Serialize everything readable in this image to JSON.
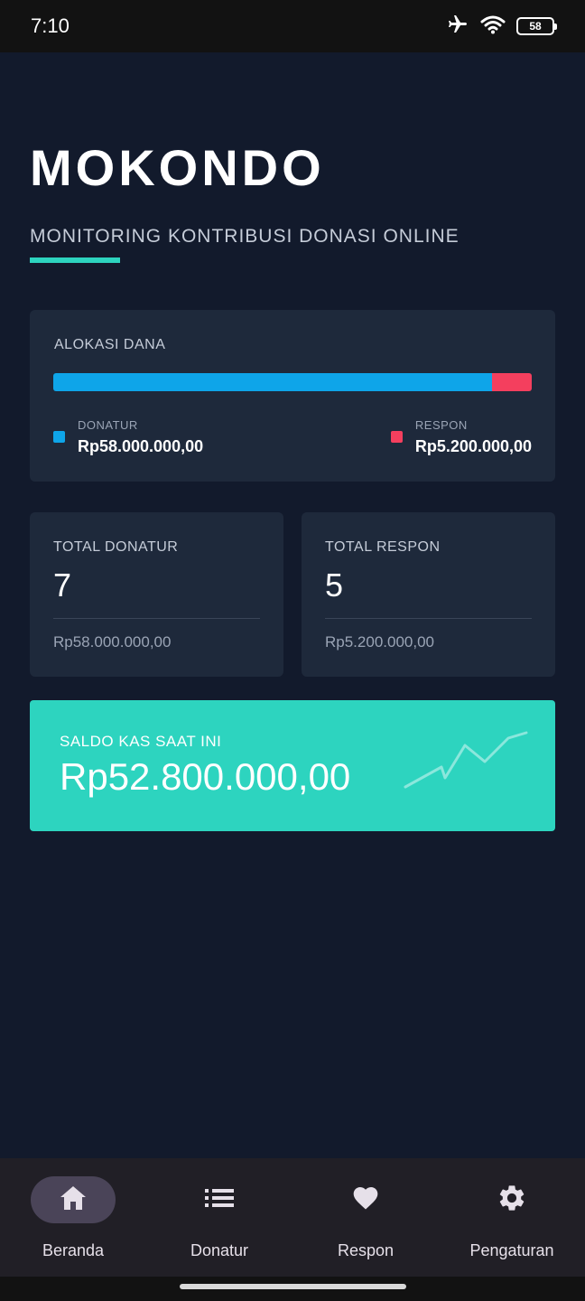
{
  "status_bar": {
    "time": "7:10",
    "battery": "58",
    "icons": [
      "airplane-icon",
      "wifi-icon",
      "battery-icon"
    ]
  },
  "header": {
    "title": "MOKONDO",
    "subtitle": "MONITORING KONTRIBUSI DONASI ONLINE"
  },
  "allocation": {
    "title": "ALOKASI DANA",
    "donatur_fraction": 0.9177,
    "donatur": {
      "label": "DONATUR",
      "value": "Rp58.000.000,00",
      "color": "#0ea5e9"
    },
    "respon": {
      "label": "RESPON",
      "value": "Rp5.200.000,00",
      "color": "#f43f5e"
    }
  },
  "stats": {
    "donatur": {
      "label": "TOTAL DONATUR",
      "count": "7",
      "amount": "Rp58.000.000,00"
    },
    "respon": {
      "label": "TOTAL RESPON",
      "count": "5",
      "amount": "Rp5.200.000,00"
    }
  },
  "balance": {
    "label": "SALDO KAS SAAT INI",
    "value": "Rp52.800.000,00",
    "color": "#2dd4bf"
  },
  "nav": {
    "items": [
      {
        "label": "Beranda",
        "icon": "home-icon",
        "active": true
      },
      {
        "label": "Donatur",
        "icon": "list-icon",
        "active": false
      },
      {
        "label": "Respon",
        "icon": "heart-icon",
        "active": false
      },
      {
        "label": "Pengaturan",
        "icon": "gear-icon",
        "active": false
      }
    ]
  },
  "colors": {
    "background": "#121a2c",
    "card": "#1e293b",
    "accent": "#2dd4bf",
    "nav_background": "#211f26",
    "nav_active_pill": "#4a4458"
  }
}
